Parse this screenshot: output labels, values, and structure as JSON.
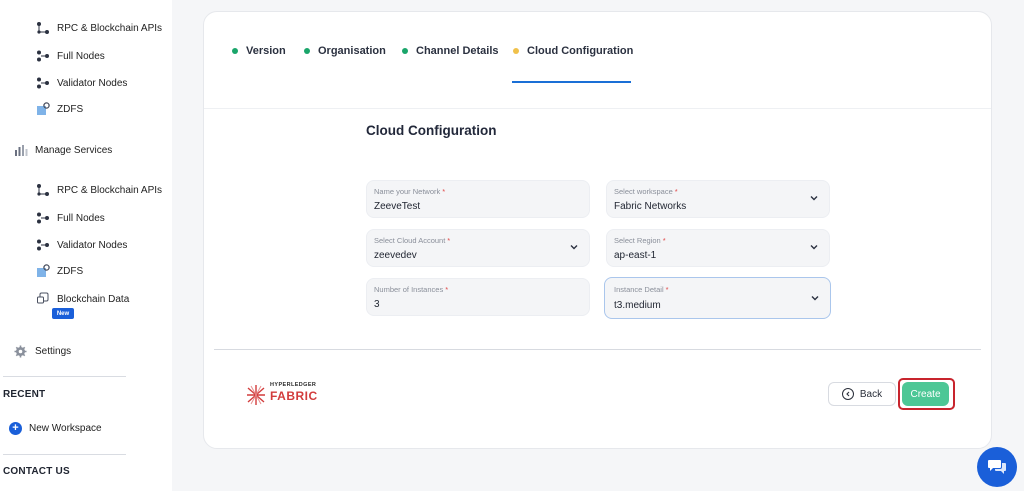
{
  "sidebar": {
    "group1": [
      {
        "label": "RPC & Blockchain APIs",
        "icon": "rpc-icon"
      },
      {
        "label": "Full Nodes",
        "icon": "nodes-icon"
      },
      {
        "label": "Validator Nodes",
        "icon": "nodes-icon"
      },
      {
        "label": "ZDFS",
        "icon": "zdfs-icon"
      }
    ],
    "manage_services": {
      "label": "Manage Services",
      "icon": "bar-chart-icon"
    },
    "group2": [
      {
        "label": "RPC & Blockchain APIs",
        "icon": "rpc-icon"
      },
      {
        "label": "Full Nodes",
        "icon": "nodes-icon"
      },
      {
        "label": "Validator Nodes",
        "icon": "nodes-icon"
      },
      {
        "label": "ZDFS",
        "icon": "zdfs-icon"
      },
      {
        "label": "Blockchain Data",
        "icon": "data-icon",
        "badge": "New"
      }
    ],
    "settings": {
      "label": "Settings",
      "icon": "gear-icon"
    },
    "recent_heading": "RECENT",
    "new_workspace": "New Workspace",
    "contact_heading": "CONTACT US"
  },
  "steps": [
    {
      "label": "Version",
      "status": "done",
      "color": "#1aa56a"
    },
    {
      "label": "Organisation",
      "status": "done",
      "color": "#1aa56a"
    },
    {
      "label": "Channel Details",
      "status": "done",
      "color": "#1aa56a"
    },
    {
      "label": "Cloud Configuration",
      "status": "active",
      "color": "#f0c14b"
    }
  ],
  "form": {
    "title": "Cloud Configuration",
    "fields": {
      "network_name": {
        "label": "Name your Network",
        "value": "ZeeveTest",
        "required": true,
        "type": "text"
      },
      "workspace": {
        "label": "Select workspace",
        "value": "Fabric Networks",
        "required": true,
        "type": "select"
      },
      "cloud_account": {
        "label": "Select Cloud Account",
        "value": "zeevedev",
        "required": true,
        "type": "select"
      },
      "region": {
        "label": "Select Region",
        "value": "ap-east-1",
        "required": true,
        "type": "select"
      },
      "instances": {
        "label": "Number of Instances",
        "value": "3",
        "required": true,
        "type": "text"
      },
      "instance_detail": {
        "label": "Instance Detail",
        "value": "t3.medium",
        "required": true,
        "type": "select"
      }
    },
    "required_mark": "*"
  },
  "footer": {
    "logo_top": "HYPERLEDGER",
    "logo_main": "FABRIC",
    "back_label": "Back",
    "create_label": "Create"
  },
  "colors": {
    "accent": "#1a5fd9",
    "create": "#4cc796",
    "highlight": "#c8242d"
  }
}
